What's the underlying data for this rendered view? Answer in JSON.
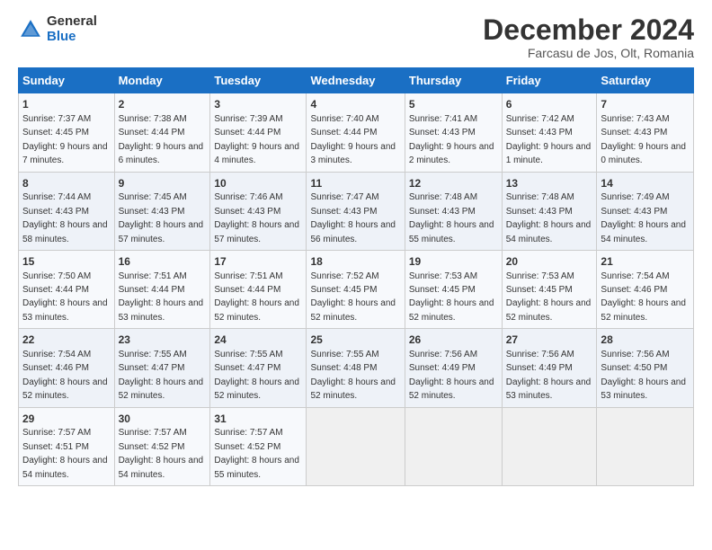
{
  "logo": {
    "general": "General",
    "blue": "Blue"
  },
  "title": "December 2024",
  "subtitle": "Farcasu de Jos, Olt, Romania",
  "days_header": [
    "Sunday",
    "Monday",
    "Tuesday",
    "Wednesday",
    "Thursday",
    "Friday",
    "Saturday"
  ],
  "weeks": [
    [
      {
        "day": "1",
        "sunrise": "Sunrise: 7:37 AM",
        "sunset": "Sunset: 4:45 PM",
        "daylight": "Daylight: 9 hours and 7 minutes."
      },
      {
        "day": "2",
        "sunrise": "Sunrise: 7:38 AM",
        "sunset": "Sunset: 4:44 PM",
        "daylight": "Daylight: 9 hours and 6 minutes."
      },
      {
        "day": "3",
        "sunrise": "Sunrise: 7:39 AM",
        "sunset": "Sunset: 4:44 PM",
        "daylight": "Daylight: 9 hours and 4 minutes."
      },
      {
        "day": "4",
        "sunrise": "Sunrise: 7:40 AM",
        "sunset": "Sunset: 4:44 PM",
        "daylight": "Daylight: 9 hours and 3 minutes."
      },
      {
        "day": "5",
        "sunrise": "Sunrise: 7:41 AM",
        "sunset": "Sunset: 4:43 PM",
        "daylight": "Daylight: 9 hours and 2 minutes."
      },
      {
        "day": "6",
        "sunrise": "Sunrise: 7:42 AM",
        "sunset": "Sunset: 4:43 PM",
        "daylight": "Daylight: 9 hours and 1 minute."
      },
      {
        "day": "7",
        "sunrise": "Sunrise: 7:43 AM",
        "sunset": "Sunset: 4:43 PM",
        "daylight": "Daylight: 9 hours and 0 minutes."
      }
    ],
    [
      {
        "day": "8",
        "sunrise": "Sunrise: 7:44 AM",
        "sunset": "Sunset: 4:43 PM",
        "daylight": "Daylight: 8 hours and 58 minutes."
      },
      {
        "day": "9",
        "sunrise": "Sunrise: 7:45 AM",
        "sunset": "Sunset: 4:43 PM",
        "daylight": "Daylight: 8 hours and 57 minutes."
      },
      {
        "day": "10",
        "sunrise": "Sunrise: 7:46 AM",
        "sunset": "Sunset: 4:43 PM",
        "daylight": "Daylight: 8 hours and 57 minutes."
      },
      {
        "day": "11",
        "sunrise": "Sunrise: 7:47 AM",
        "sunset": "Sunset: 4:43 PM",
        "daylight": "Daylight: 8 hours and 56 minutes."
      },
      {
        "day": "12",
        "sunrise": "Sunrise: 7:48 AM",
        "sunset": "Sunset: 4:43 PM",
        "daylight": "Daylight: 8 hours and 55 minutes."
      },
      {
        "day": "13",
        "sunrise": "Sunrise: 7:48 AM",
        "sunset": "Sunset: 4:43 PM",
        "daylight": "Daylight: 8 hours and 54 minutes."
      },
      {
        "day": "14",
        "sunrise": "Sunrise: 7:49 AM",
        "sunset": "Sunset: 4:43 PM",
        "daylight": "Daylight: 8 hours and 54 minutes."
      }
    ],
    [
      {
        "day": "15",
        "sunrise": "Sunrise: 7:50 AM",
        "sunset": "Sunset: 4:44 PM",
        "daylight": "Daylight: 8 hours and 53 minutes."
      },
      {
        "day": "16",
        "sunrise": "Sunrise: 7:51 AM",
        "sunset": "Sunset: 4:44 PM",
        "daylight": "Daylight: 8 hours and 53 minutes."
      },
      {
        "day": "17",
        "sunrise": "Sunrise: 7:51 AM",
        "sunset": "Sunset: 4:44 PM",
        "daylight": "Daylight: 8 hours and 52 minutes."
      },
      {
        "day": "18",
        "sunrise": "Sunrise: 7:52 AM",
        "sunset": "Sunset: 4:45 PM",
        "daylight": "Daylight: 8 hours and 52 minutes."
      },
      {
        "day": "19",
        "sunrise": "Sunrise: 7:53 AM",
        "sunset": "Sunset: 4:45 PM",
        "daylight": "Daylight: 8 hours and 52 minutes."
      },
      {
        "day": "20",
        "sunrise": "Sunrise: 7:53 AM",
        "sunset": "Sunset: 4:45 PM",
        "daylight": "Daylight: 8 hours and 52 minutes."
      },
      {
        "day": "21",
        "sunrise": "Sunrise: 7:54 AM",
        "sunset": "Sunset: 4:46 PM",
        "daylight": "Daylight: 8 hours and 52 minutes."
      }
    ],
    [
      {
        "day": "22",
        "sunrise": "Sunrise: 7:54 AM",
        "sunset": "Sunset: 4:46 PM",
        "daylight": "Daylight: 8 hours and 52 minutes."
      },
      {
        "day": "23",
        "sunrise": "Sunrise: 7:55 AM",
        "sunset": "Sunset: 4:47 PM",
        "daylight": "Daylight: 8 hours and 52 minutes."
      },
      {
        "day": "24",
        "sunrise": "Sunrise: 7:55 AM",
        "sunset": "Sunset: 4:47 PM",
        "daylight": "Daylight: 8 hours and 52 minutes."
      },
      {
        "day": "25",
        "sunrise": "Sunrise: 7:55 AM",
        "sunset": "Sunset: 4:48 PM",
        "daylight": "Daylight: 8 hours and 52 minutes."
      },
      {
        "day": "26",
        "sunrise": "Sunrise: 7:56 AM",
        "sunset": "Sunset: 4:49 PM",
        "daylight": "Daylight: 8 hours and 52 minutes."
      },
      {
        "day": "27",
        "sunrise": "Sunrise: 7:56 AM",
        "sunset": "Sunset: 4:49 PM",
        "daylight": "Daylight: 8 hours and 53 minutes."
      },
      {
        "day": "28",
        "sunrise": "Sunrise: 7:56 AM",
        "sunset": "Sunset: 4:50 PM",
        "daylight": "Daylight: 8 hours and 53 minutes."
      }
    ],
    [
      {
        "day": "29",
        "sunrise": "Sunrise: 7:57 AM",
        "sunset": "Sunset: 4:51 PM",
        "daylight": "Daylight: 8 hours and 54 minutes."
      },
      {
        "day": "30",
        "sunrise": "Sunrise: 7:57 AM",
        "sunset": "Sunset: 4:52 PM",
        "daylight": "Daylight: 8 hours and 54 minutes."
      },
      {
        "day": "31",
        "sunrise": "Sunrise: 7:57 AM",
        "sunset": "Sunset: 4:52 PM",
        "daylight": "Daylight: 8 hours and 55 minutes."
      },
      null,
      null,
      null,
      null
    ]
  ]
}
